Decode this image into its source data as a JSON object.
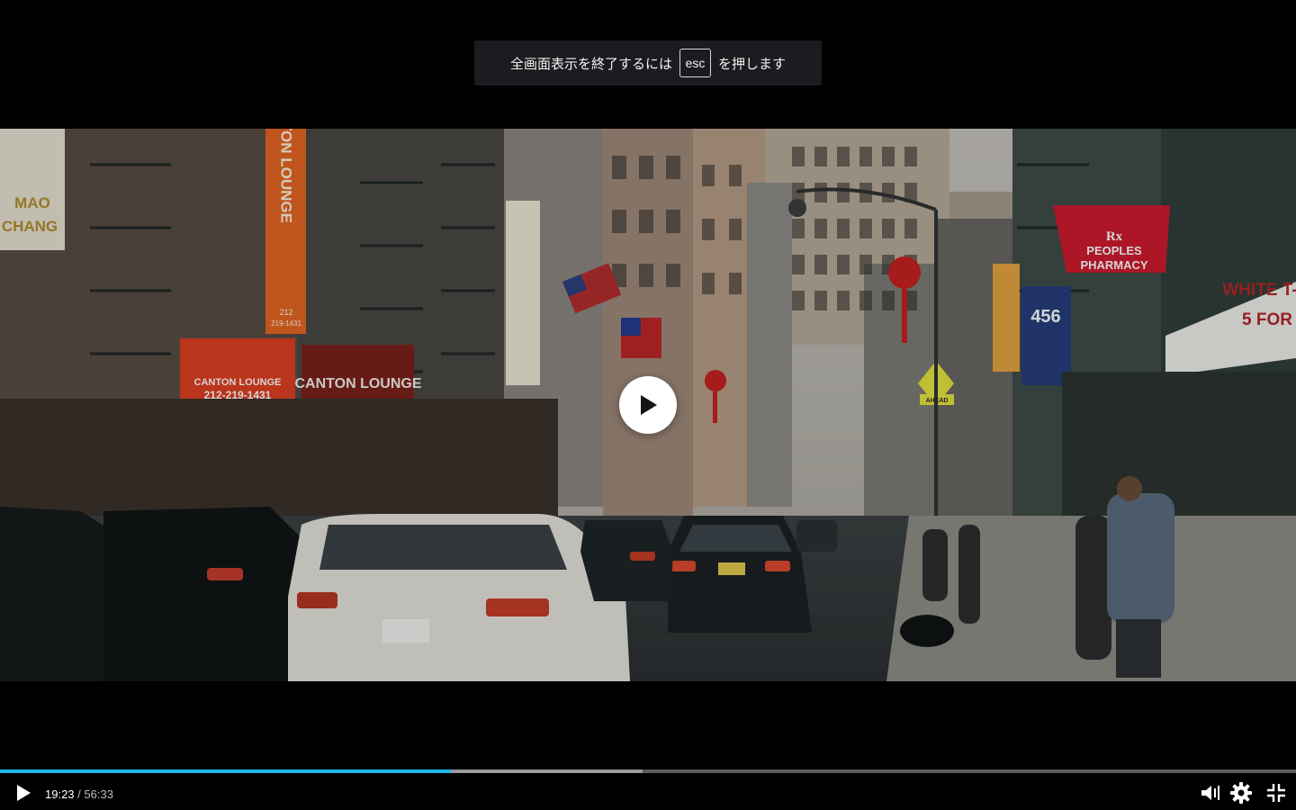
{
  "fullscreen_hint": {
    "before": "全画面表示を終了するには",
    "key": "esc",
    "after": "を押します"
  },
  "video": {
    "signs": {
      "mao_chang_1": "MAO",
      "mao_chang_2": "CHANG",
      "canton_vertical": "CANTON LOUNGE",
      "canton_num_1": "212",
      "canton_num_2": "219-1431",
      "canton_box_title": "CANTON LOUNGE",
      "canton_box_phone": "212-219-1431",
      "canton_awning": "CANTON LOUNGE",
      "pharmacy_1": "PEOPLES",
      "pharmacy_2": "PHARMACY",
      "rx": "Rx",
      "white_t_1": "WHITE T-",
      "white_t_2": "5 FOR",
      "num_sign": "456",
      "ahead": "AHEAD"
    }
  },
  "controls": {
    "current_time": "19:23",
    "separator": "/",
    "duration": "56:33",
    "progress_played": 0.348,
    "progress_buffered": 0.496
  },
  "colors": {
    "accent": "#1fb6e8",
    "toast_bg": "#1c1c20"
  },
  "icons": {
    "play": "play-icon",
    "big_play": "play-circle-icon",
    "volume": "volume-muted-icon",
    "settings": "gear-icon",
    "exit_fullscreen": "exit-fullscreen-icon"
  }
}
